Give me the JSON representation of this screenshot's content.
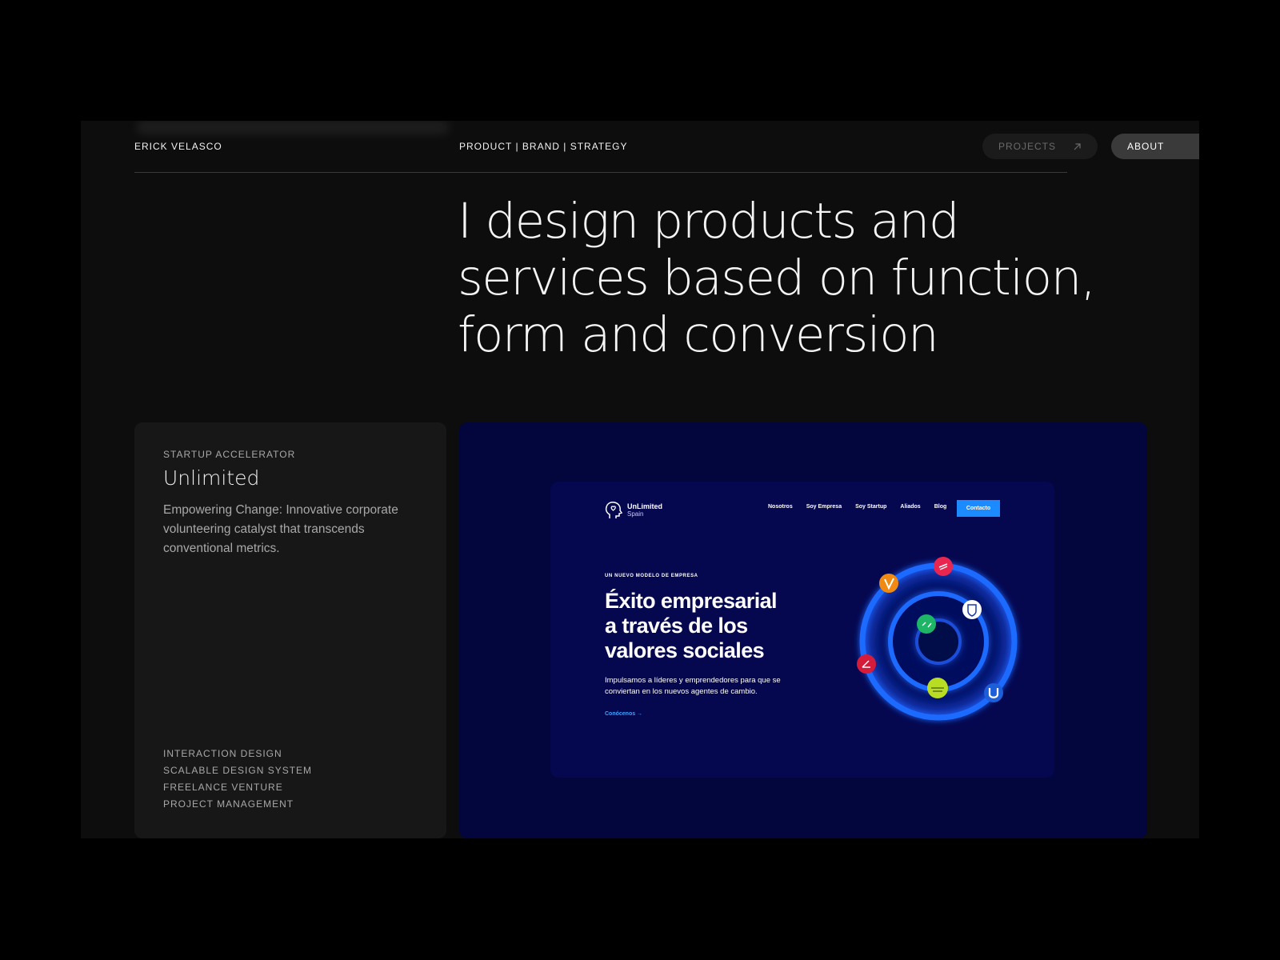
{
  "header": {
    "brand": "ERICK VELASCO",
    "tagline": "PRODUCT | BRAND | STRATEGY",
    "nav": [
      {
        "label": "PROJECTS",
        "icon": "arrow-up-right-icon"
      },
      {
        "label": "ABOUT",
        "icon": "arrow-up-right-icon"
      }
    ]
  },
  "hero": {
    "headline": "I design products and\nservices based on function,\nform and conversion"
  },
  "project": {
    "category": "STARTUP ACCELERATOR",
    "title": "Unlimited",
    "description": "Empowering Change: Innovative corporate volunteering catalyst that transcends conventional metrics.",
    "tags": [
      "INTERACTION DESIGN",
      "SCALABLE DESIGN SYSTEM",
      "FREELANCE VENTURE",
      "PROJECT MANAGEMENT"
    ]
  },
  "preview": {
    "logo_name": "UnLimited",
    "logo_sub": "Spain",
    "nav": [
      "Nosotros",
      "Soy Empresa",
      "Soy Startup",
      "Aliados",
      "Blog"
    ],
    "contact": "Contacto",
    "eyebrow": "UN NUEVO MODELO DE EMPRESA",
    "headline": "Éxito empresarial\na través de los\nvalores sociales",
    "body": "Impulsamos a líderes y emprendedores para que se conviertan en los nuevos agentes de cambio.",
    "link": "Conócenos →"
  },
  "colors": {
    "frame_bg": "#0d0d0d",
    "card_bg": "#171717",
    "preview_bg": "#03053d",
    "accent_blue": "#1b8bff"
  }
}
